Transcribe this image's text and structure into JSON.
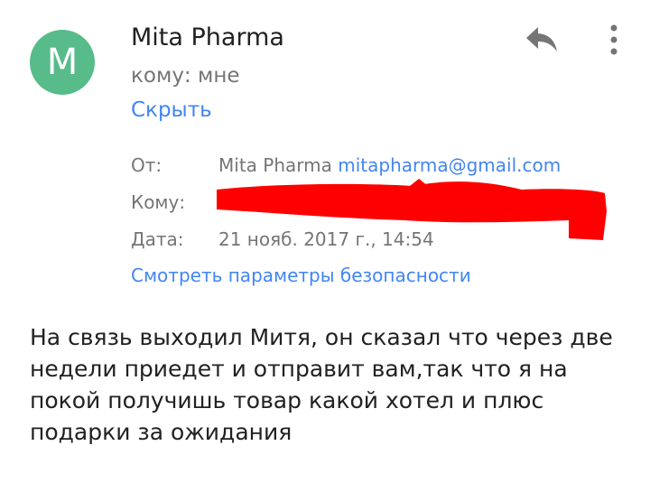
{
  "header": {
    "avatar_letter": "M",
    "avatar_color": "#57bb8a",
    "sender_name": "Mita Pharma",
    "to_line": "кому: мне",
    "hide_label": "Скрыть",
    "reply_icon": "reply-icon",
    "menu_icon": "more-vert-icon"
  },
  "details": {
    "from_label": "От:",
    "from_name": "Mita Pharma",
    "from_email": "mitapharma@gmail.com",
    "to_label": "Кому:",
    "date_label": "Дата:",
    "date_value": "21 нояб. 2017 г., 14:54",
    "security_link": "Смотреть параметры безопасности"
  },
  "message": {
    "body": "На связь выходил Митя, он сказал что через две недели приедет и отправит вам,так что я на покой получишь товар какой хотел и плюс подарки за ожидания"
  },
  "colors": {
    "link": "#4285f4",
    "secondary_text": "#757575",
    "primary_text": "#212121",
    "redaction": "#ff0000"
  }
}
